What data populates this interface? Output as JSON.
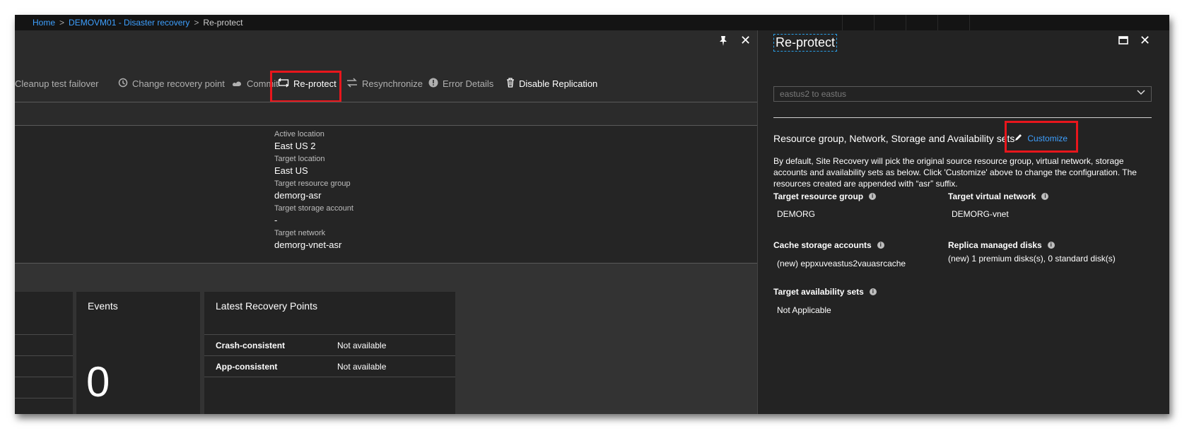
{
  "breadcrumb": {
    "home": "Home",
    "item": "DEMOVM01 - Disaster recovery",
    "current": "Re-protect"
  },
  "toolbar": {
    "cleanup_test_failover": "Cleanup test failover",
    "change_recovery_point": "Change recovery point",
    "commit": "Commit",
    "reprotect": "Re-protect",
    "resynchronize": "Resynchronize",
    "error_details": "Error Details",
    "disable_replication": "Disable Replication"
  },
  "essentials": {
    "active_location_label": "Active location",
    "active_location_value": "East US 2",
    "target_location_label": "Target location",
    "target_location_value": "East US",
    "target_resource_group_label": "Target resource group",
    "target_resource_group_value": "demorg-asr",
    "target_storage_account_label": "Target storage account",
    "target_storage_account_value": "-",
    "target_network_label": "Target network",
    "target_network_value": "demorg-vnet-asr"
  },
  "tiles": {
    "events_title": "Events",
    "events_count": "0",
    "recovery_points_title": "Latest Recovery Points",
    "rows": [
      {
        "label": "Crash-consistent",
        "value": "Not available"
      },
      {
        "label": "App-consistent",
        "value": "Not available"
      }
    ]
  },
  "right_blade": {
    "title": "Re-protect",
    "direction_select": "eastus2 to eastus",
    "section_heading": "Resource group, Network, Storage and Availability sets",
    "customize_link": "Customize",
    "description": "By default, Site Recovery will pick the original source resource group, virtual network, storage accounts and availability sets as below. Click 'Customize' above to change the configuration. The resources created are appended with “asr” suffix.",
    "fields": {
      "target_resource_group_label": "Target resource group",
      "target_resource_group_value": "DEMORG",
      "target_virtual_network_label": "Target virtual network",
      "target_virtual_network_value": "DEMORG-vnet",
      "cache_storage_accounts_label": "Cache storage accounts",
      "cache_storage_accounts_value": "(new) eppxuveastus2vauasrcache",
      "replica_managed_disks_label": "Replica managed disks",
      "replica_managed_disks_value": "(new) 1 premium disks(s), 0 standard disk(s)",
      "target_availability_sets_label": "Target availability sets",
      "target_availability_sets_value": "Not Applicable"
    }
  },
  "colors": {
    "accent_blue": "#3ea0ff",
    "highlight_red": "#e8161c",
    "panel_dark": "#232323"
  },
  "icons": {
    "pin": "pin-icon",
    "close": "close-icon",
    "maximize": "maximize-icon",
    "history": "history-icon",
    "commit": "commit-icon",
    "reprotect": "reprotect-icon",
    "resync": "resync-icon",
    "error": "error-icon",
    "trash": "trash-icon",
    "pencil": "pencil-icon",
    "info": "info-icon",
    "chevron": "chevron-down-icon"
  }
}
